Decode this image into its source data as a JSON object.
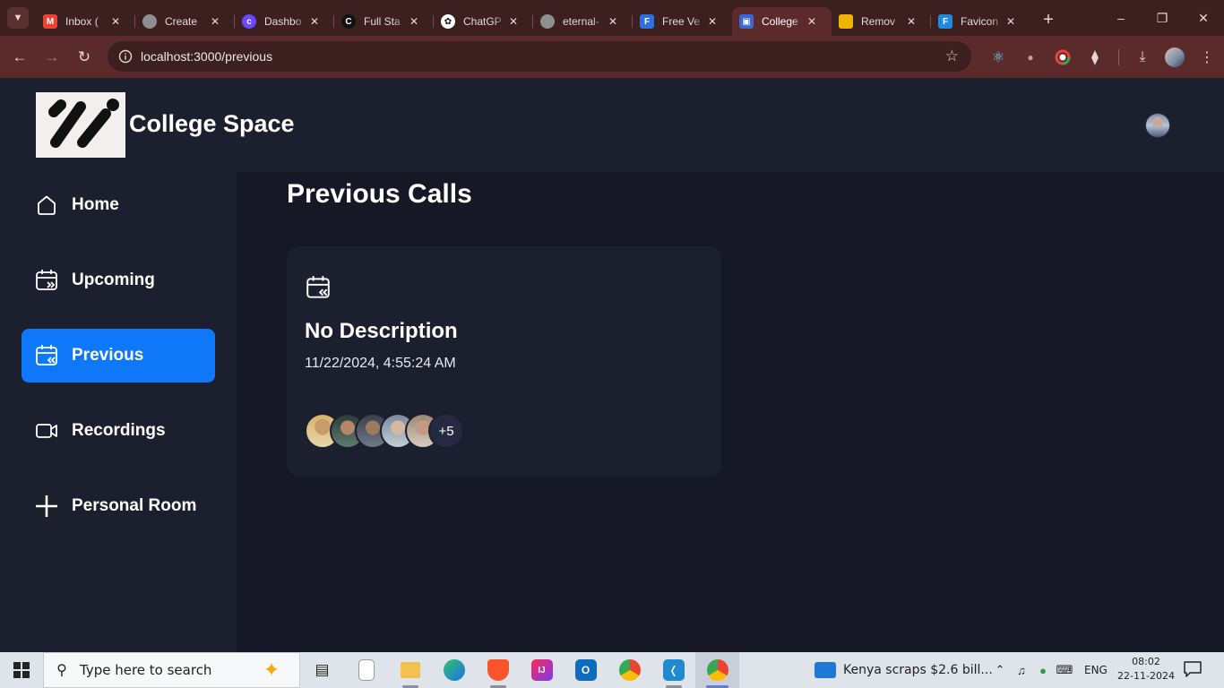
{
  "browser": {
    "tabs": [
      {
        "title": "Inbox (",
        "favicon": "gmail-icon",
        "color": "#ea4335"
      },
      {
        "title": "Create",
        "favicon": "globe-icon",
        "color": "#8f8f8f"
      },
      {
        "title": "Dashbo",
        "favicon": "clerk-icon",
        "color": "#6c47ff"
      },
      {
        "title": "Full Sta",
        "favicon": "c-icon",
        "color": "#111111"
      },
      {
        "title": "ChatGP",
        "favicon": "chatgpt-icon",
        "color": "#2b2b2b"
      },
      {
        "title": "eternal-",
        "favicon": "globe-icon",
        "color": "#8f8f8f"
      },
      {
        "title": "Free Ve",
        "favicon": "f-icon",
        "color": "#2f6fe4"
      },
      {
        "title": "College",
        "favicon": "college-space-icon",
        "color": "#3867d6"
      },
      {
        "title": "Remov",
        "favicon": "remove-icon",
        "color": "#f0b400"
      },
      {
        "title": "Favicon",
        "favicon": "favicon-icon",
        "color": "#1e88e5"
      }
    ],
    "url": "localhost:3000/previous"
  },
  "app": {
    "brand": "College Space",
    "sidebar": [
      {
        "label": "Home",
        "icon": "home-icon"
      },
      {
        "label": "Upcoming",
        "icon": "calendar-forward-icon"
      },
      {
        "label": "Previous",
        "icon": "calendar-back-icon",
        "active": true
      },
      {
        "label": "Recordings",
        "icon": "video-icon"
      },
      {
        "label": "Personal Room",
        "icon": "plus-icon"
      }
    ],
    "page_title": "Previous Calls",
    "card": {
      "title": "No Description",
      "date": "11/22/2024, 4:55:24 AM",
      "more_count": "+5"
    },
    "accent": "#0e78f9"
  },
  "taskbar": {
    "search_placeholder": "Type here to search",
    "news": "Kenya scraps $2.6 bill...",
    "lang": "ENG",
    "time": "08:02",
    "date": "22-11-2024"
  }
}
